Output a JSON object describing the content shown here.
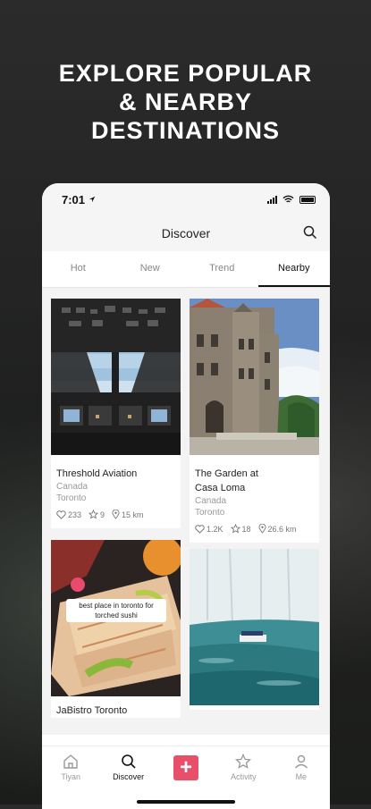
{
  "headline": [
    "EXPLORE POPULAR",
    "& NEARBY",
    "DESTINATIONS"
  ],
  "status": {
    "time": "7:01"
  },
  "header": {
    "title": "Discover"
  },
  "tabs": [
    "Hot",
    "New",
    "Trend",
    "Nearby"
  ],
  "active_tab": "Nearby",
  "cards": [
    {
      "name": "Threshold Aviation",
      "country": "Canada",
      "city": "Toronto",
      "likes": "233",
      "stars": "9",
      "distance": "15 km"
    },
    {
      "name_line1": "The Garden at",
      "name_line2": "Casa Loma",
      "country": "Canada",
      "city": "Toronto",
      "likes": "1.2K",
      "stars": "18",
      "distance": "26.6 km"
    },
    {
      "name": "JaBistro Toronto",
      "caption_line1": "best place in toronto for",
      "caption_line2": "torched sushi"
    },
    {
      "name": ""
    }
  ],
  "tabbar": {
    "home": "Tiyan",
    "discover": "Discover",
    "activity": "Activity",
    "me": "Me"
  },
  "colors": {
    "accent": "#e8506a"
  }
}
